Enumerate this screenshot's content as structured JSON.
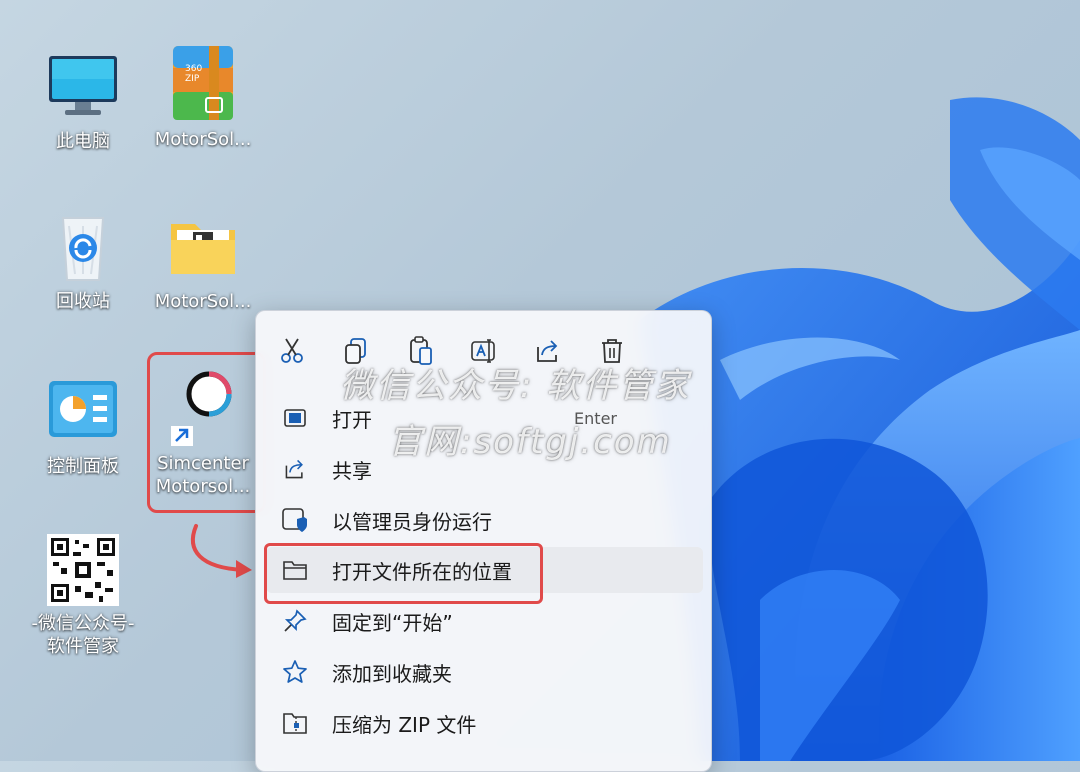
{
  "desktop": {
    "icons": [
      {
        "label": "此电脑"
      },
      {
        "label": "MotorSol..."
      },
      {
        "label": "回收站"
      },
      {
        "label": "MotorSol..."
      },
      {
        "label": "控制面板"
      },
      {
        "label": "Simcenter\nMotorsol..."
      },
      {
        "label": "-微信公众号-\n软件管家"
      }
    ],
    "zip_badge": "360\nZIP"
  },
  "context_menu": {
    "toolbar": [
      {
        "icon": "cut-icon"
      },
      {
        "icon": "copy-icon"
      },
      {
        "icon": "paste-icon"
      },
      {
        "icon": "rename-icon"
      },
      {
        "icon": "share-icon"
      },
      {
        "icon": "delete-icon"
      }
    ],
    "items": [
      {
        "label": "打开",
        "shortcut": "Enter",
        "icon": "open-app-icon"
      },
      {
        "label": "共享",
        "icon": "share-icon"
      },
      {
        "label": "以管理员身份运行",
        "icon": "shield-icon"
      },
      {
        "label": "打开文件所在的位置",
        "icon": "folder-icon"
      },
      {
        "label": "固定到“开始”",
        "icon": "pin-icon"
      },
      {
        "label": "添加到收藏夹",
        "icon": "star-icon"
      },
      {
        "label": "压缩为 ZIP 文件",
        "icon": "zip-icon"
      }
    ]
  },
  "watermark": {
    "line1": "微信公众号: 软件管家",
    "line2": "官网:softgj.com"
  },
  "colors": {
    "highlight": "#e04a4a",
    "wallpaper_blue": "#1f6fe6",
    "accent": "#0067c0"
  }
}
